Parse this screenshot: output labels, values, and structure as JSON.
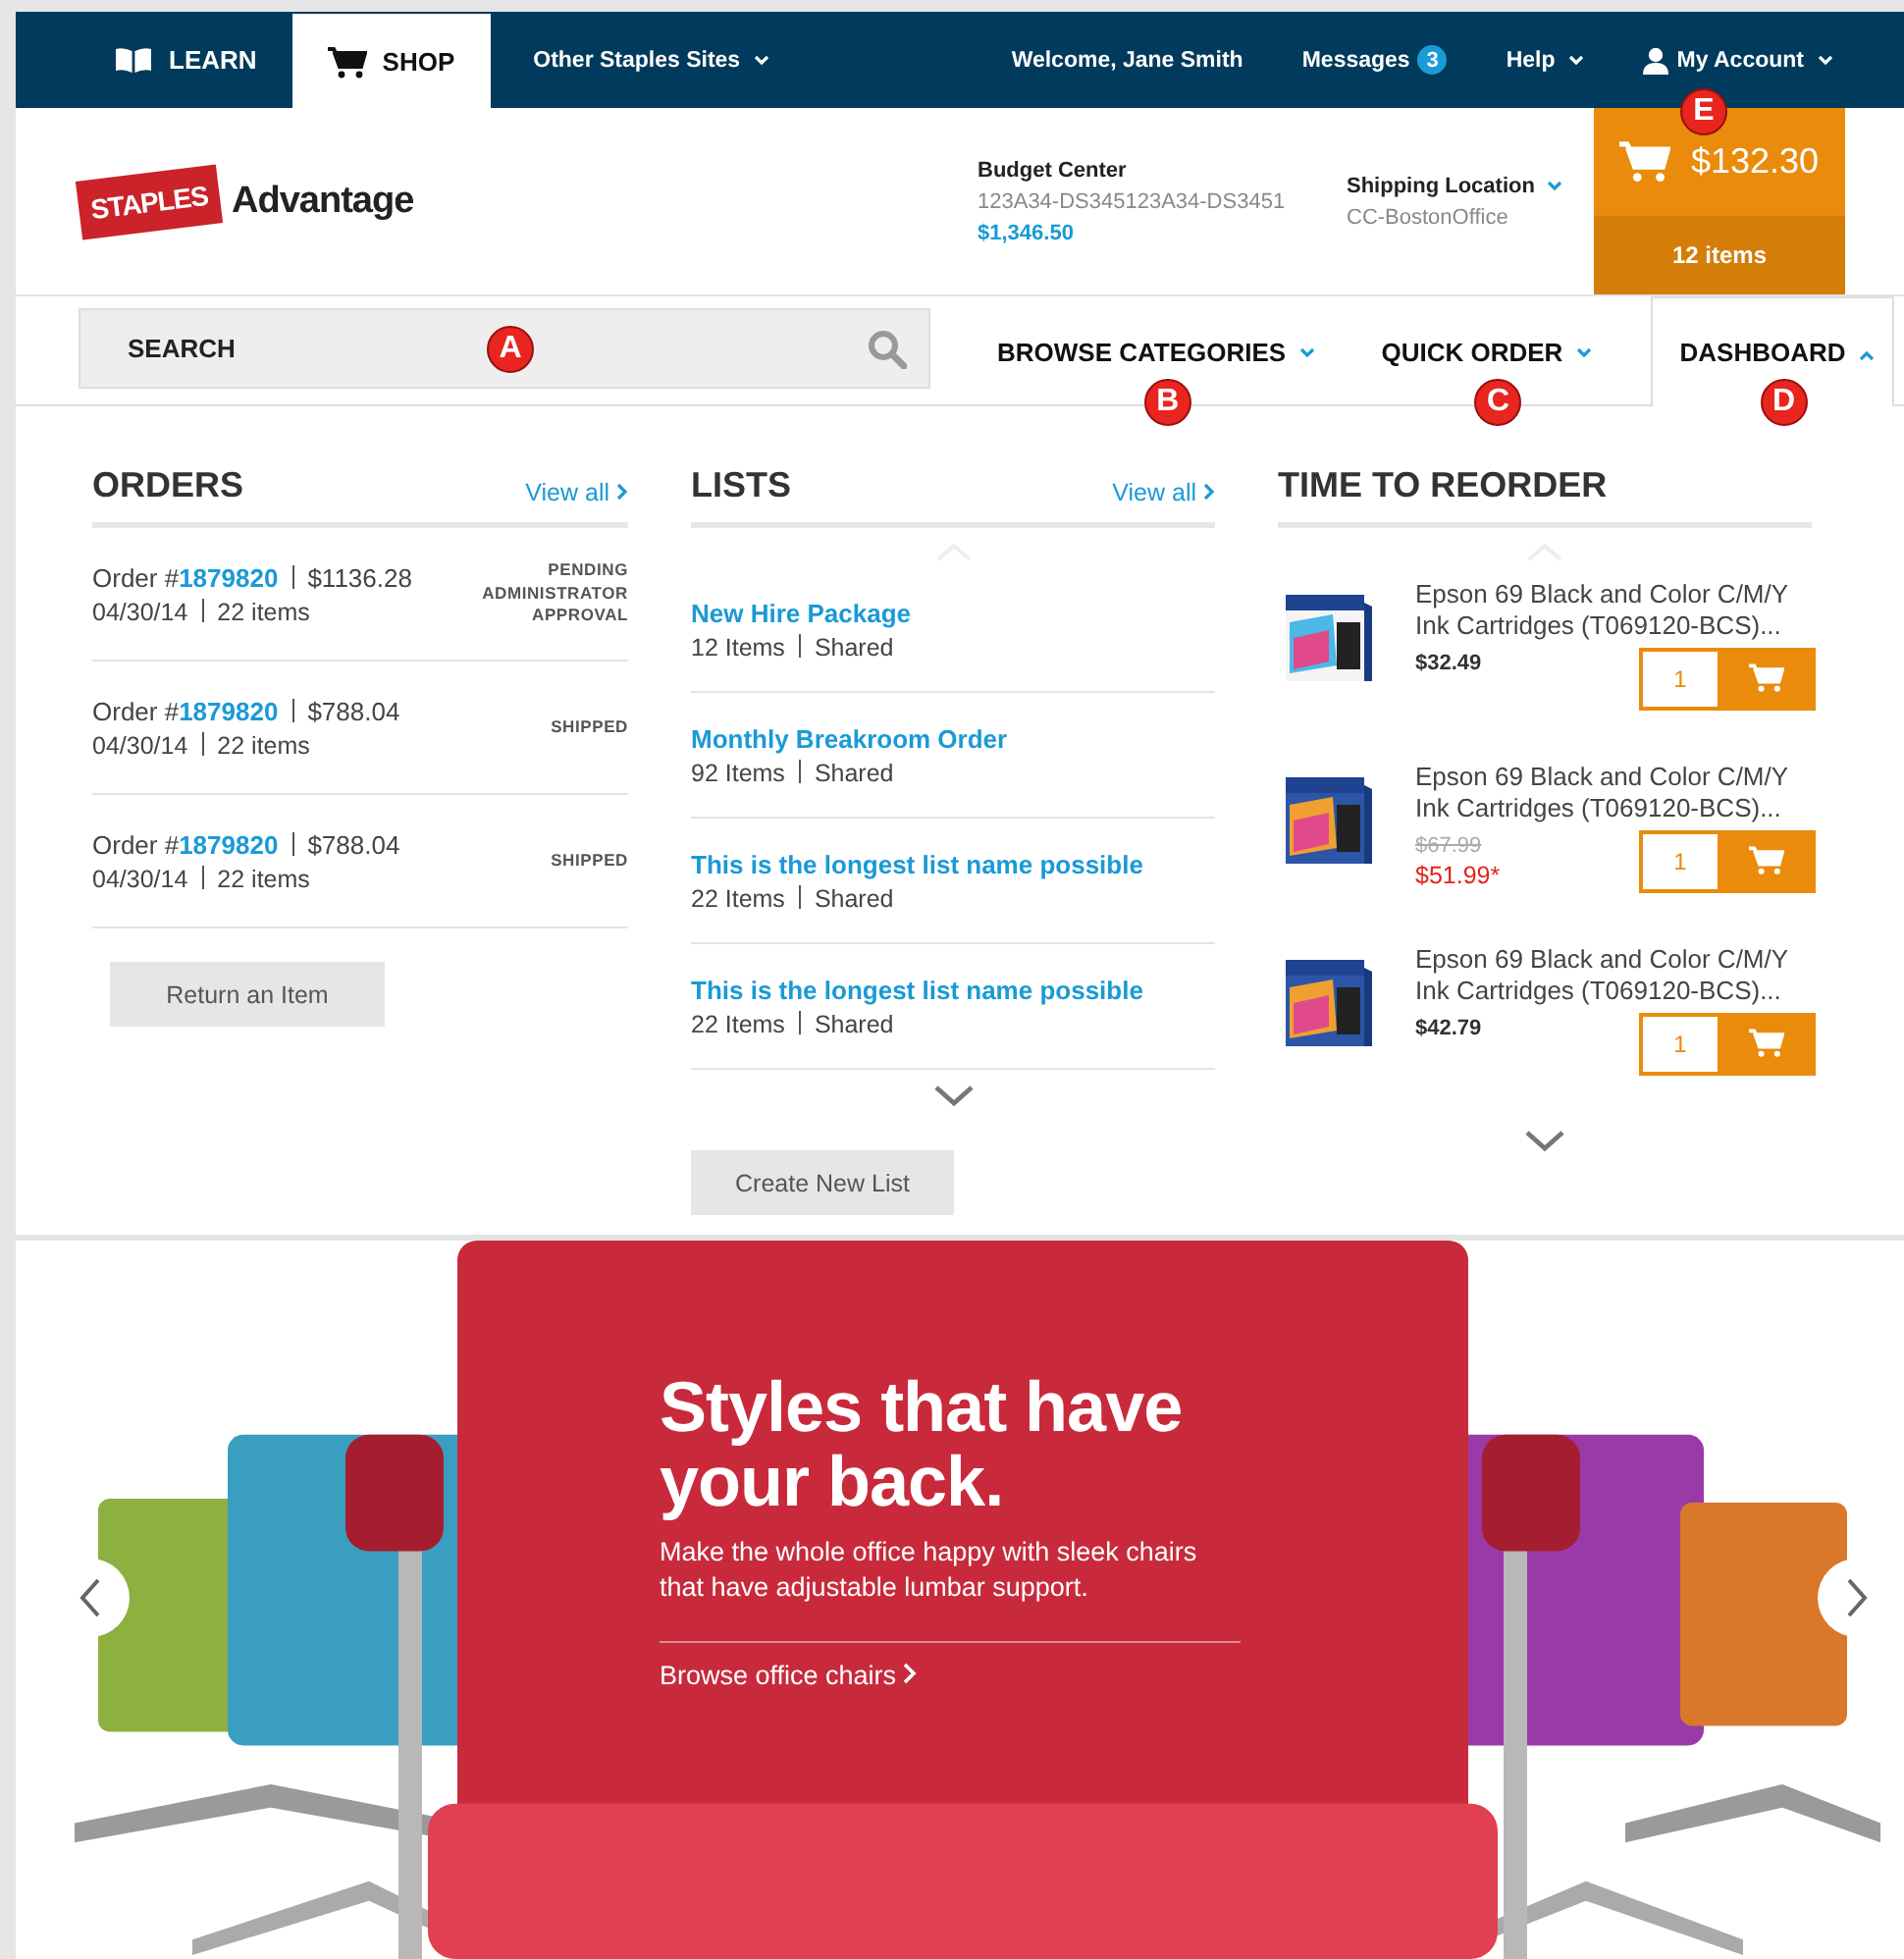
{
  "top_bar": {
    "tabs": [
      {
        "label": "LEARN",
        "selected": false
      },
      {
        "label": "SHOP",
        "selected": true
      }
    ],
    "sites_menu": "Other Staples Sites",
    "welcome": "Welcome, Jane Smith",
    "messages": {
      "label": "Messages",
      "count": "3"
    },
    "help": "Help",
    "account": "My Account"
  },
  "header": {
    "logo": {
      "brand": "STAPLES",
      "product": "Advantage"
    },
    "budget": {
      "title": "Budget Center",
      "code": "123A34-DS345123A34-DS3451",
      "amount": "$1,346.50"
    },
    "shipping": {
      "title": "Shipping Location",
      "value": "CC-BostonOffice"
    },
    "cart": {
      "total": "$132.30",
      "items": "12 items",
      "marker": "E"
    }
  },
  "nav": {
    "search": {
      "placeholder": "SEARCH",
      "marker": "A"
    },
    "items": [
      {
        "label": "BROWSE CATEGORIES",
        "expanded": false,
        "selected": false,
        "marker": "B"
      },
      {
        "label": "QUICK ORDER",
        "expanded": false,
        "selected": false,
        "marker": "C"
      },
      {
        "label": "DASHBOARD",
        "expanded": true,
        "selected": true,
        "marker": "D"
      }
    ]
  },
  "orders": {
    "title": "ORDERS",
    "view_all": "View all",
    "rows": [
      {
        "prefix": "Order #",
        "number": "1879820",
        "total": "$1136.28",
        "date": "04/30/14",
        "items": "22 items",
        "status": "PENDING ADMINISTRATOR APPROVAL"
      },
      {
        "prefix": "Order #",
        "number": "1879820",
        "total": "$788.04",
        "date": "04/30/14",
        "items": "22 items",
        "status": "SHIPPED"
      },
      {
        "prefix": "Order #",
        "number": "1879820",
        "total": "$788.04",
        "date": "04/30/14",
        "items": "22 items",
        "status": "SHIPPED"
      }
    ],
    "button": "Return an Item"
  },
  "lists": {
    "title": "LISTS",
    "view_all": "View all",
    "rows": [
      {
        "name": "New Hire Package",
        "count": "12 Items",
        "sharing": "Shared"
      },
      {
        "name": "Monthly Breakroom Order",
        "count": "92 Items",
        "sharing": "Shared"
      },
      {
        "name": "This is the longest list name possible",
        "count": "22 Items",
        "sharing": "Shared"
      },
      {
        "name": "This is the longest list name possible",
        "count": "22 Items",
        "sharing": "Shared"
      }
    ],
    "button": "Create New List"
  },
  "reorder": {
    "title": "TIME TO REORDER",
    "products": [
      {
        "name": "Epson 69 Black and Color C/M/Y Ink Cartridges (T069120-BCS)...",
        "price": "$32.49",
        "quantity": "1"
      },
      {
        "name": "Epson 69 Black and Color C/M/Y Ink Cartridges (T069120-BCS)...",
        "old_price": "$67.99",
        "price": "$51.99*",
        "quantity": "1"
      },
      {
        "name": "Epson 69 Black and Color C/M/Y Ink Cartridges (T069120-BCS)...",
        "price": "$42.79",
        "quantity": "1"
      }
    ]
  },
  "hero": {
    "kind": "picture",
    "headline": "Styles that have your back.",
    "text": "Make the whole office happy with sleek chairs that have adjustable lumbar support.",
    "link": "Browse office chairs"
  }
}
